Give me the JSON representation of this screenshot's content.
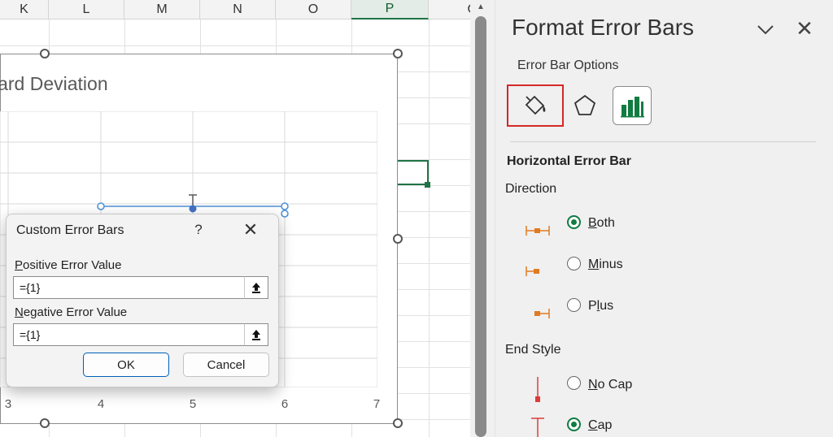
{
  "sheet": {
    "columns": [
      "K",
      "L",
      "M",
      "N",
      "O",
      "P",
      "C"
    ],
    "selected_column": "P"
  },
  "chart": {
    "title": "lard Deviation",
    "x_ticks": [
      "3",
      "4",
      "5",
      "6",
      "7"
    ]
  },
  "dialog": {
    "title": "Custom Error Bars",
    "help": "?",
    "close": "✕",
    "positive_label_hot": "P",
    "positive_label_rest": "ositive Error Value",
    "positive_value": "={1}",
    "negative_label_hot": "N",
    "negative_label_rest": "egative Error Value",
    "negative_value": "={1}",
    "ok": "OK",
    "cancel": "Cancel"
  },
  "pane": {
    "title": "Format Error Bars",
    "subtitle": "Error Bar Options",
    "close": "✕",
    "section": "Horizontal Error Bar",
    "direction_label": "Direction",
    "direction_options": [
      {
        "hot": "B",
        "rest": "oth",
        "selected": true
      },
      {
        "hot": "M",
        "rest": "inus",
        "selected": false
      },
      {
        "pre": "P",
        "hot": "l",
        "rest": "us",
        "selected": false
      }
    ],
    "end_style_label": "End Style",
    "end_options": [
      {
        "hot": "N",
        "rest": "o Cap",
        "selected": false
      },
      {
        "hot": "C",
        "rest": "ap",
        "selected": true
      }
    ],
    "accent": "#107c41",
    "errorbar_color": "#e07b20",
    "cap_color": "#e03a3a"
  }
}
